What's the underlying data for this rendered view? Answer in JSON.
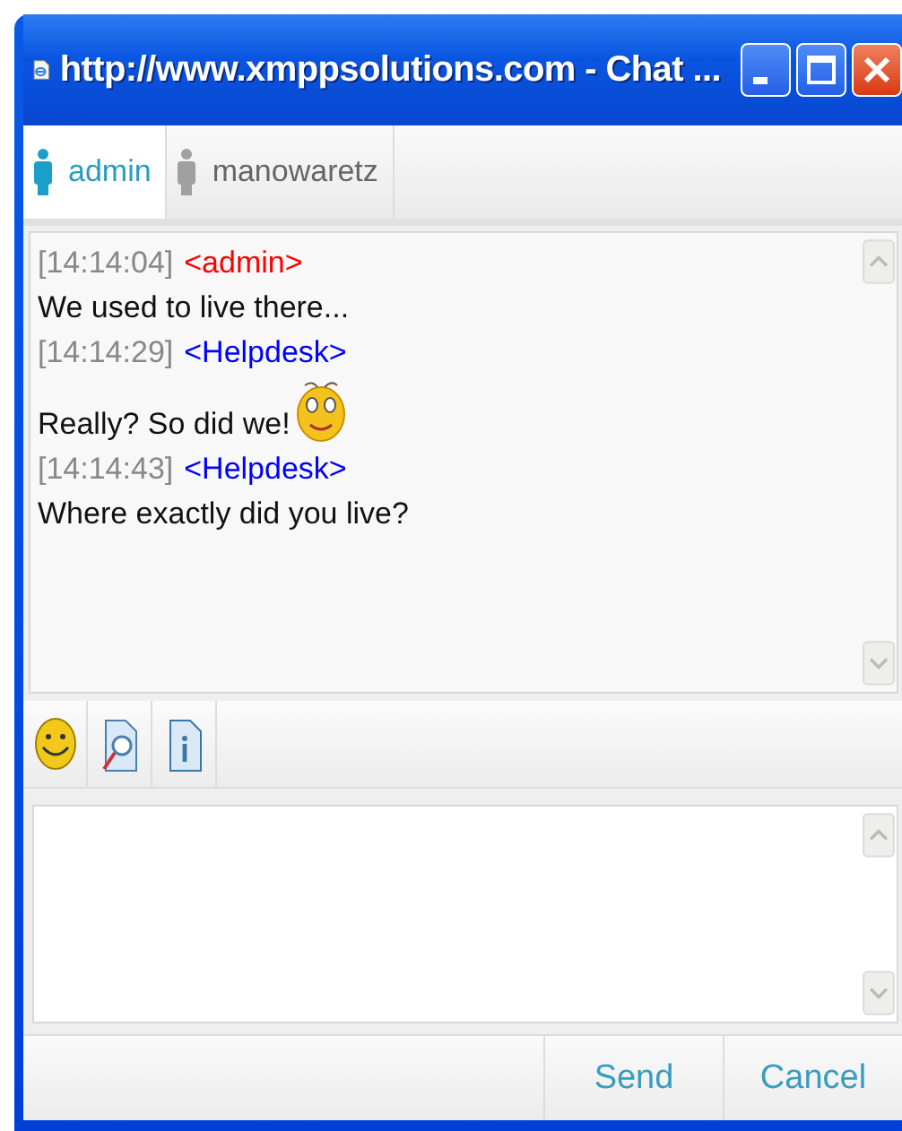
{
  "window": {
    "title": "http://www.xmppsolutions.com - Chat ..."
  },
  "tabs": [
    {
      "label": "admin",
      "selected": true
    },
    {
      "label": "manowaretz",
      "selected": false
    }
  ],
  "messages": [
    {
      "time": "[14:14:04]",
      "sender": "<admin>",
      "color": "#ff0000",
      "text": "We used to live there...",
      "emoticon": false
    },
    {
      "time": "[14:14:29]",
      "sender": "<Helpdesk>",
      "color": "#0000ff",
      "text": "Really? So did we!",
      "emoticon": true
    },
    {
      "time": "[14:14:43]",
      "sender": "<Helpdesk>",
      "color": "#0000ff",
      "text": "Where exactly did you live?",
      "emoticon": false
    }
  ],
  "buttons": [
    "Send",
    "Cancel"
  ]
}
